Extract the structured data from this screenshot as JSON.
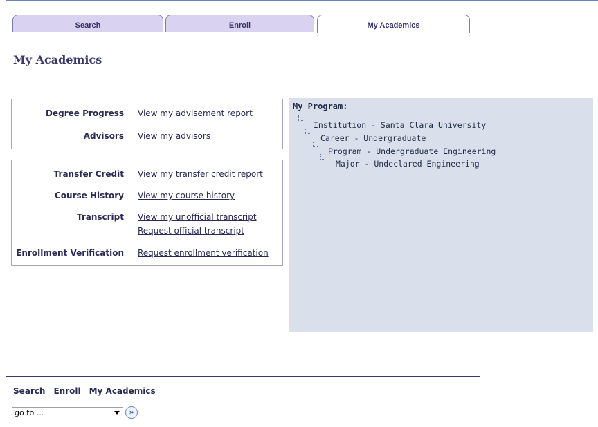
{
  "tabs": [
    {
      "label": "Search",
      "active": false
    },
    {
      "label": "Enroll",
      "active": false
    },
    {
      "label": "My Academics",
      "active": true
    }
  ],
  "page_title": "My Academics",
  "section1": [
    {
      "label": "Degree Progress",
      "links": [
        "View my advisement report"
      ]
    },
    {
      "label": "Advisors",
      "links": [
        "View my advisors"
      ]
    }
  ],
  "section2": [
    {
      "label": "Transfer Credit",
      "links": [
        "View my transfer credit report"
      ]
    },
    {
      "label": "Course History",
      "links": [
        "View my course history"
      ]
    },
    {
      "label": "Transcript",
      "links": [
        "View my unofficial transcript",
        "Request official transcript"
      ]
    },
    {
      "label": "Enrollment Verification",
      "links": [
        "Request enrollment verification"
      ]
    }
  ],
  "program": {
    "title": "My Program:",
    "tree": [
      "Institution - Santa Clara University",
      "Career - Undergraduate",
      "Program - Undergraduate Engineering",
      "Major - Undeclared Engineering"
    ]
  },
  "footer": {
    "links": [
      "Search",
      "Enroll",
      "My Academics"
    ],
    "goto": {
      "value": "go to ..."
    },
    "go_icon": "double-chevron-right-icon"
  },
  "colors": {
    "tab_bg": "#d9d2f0",
    "panel_bg": "#dae0eb",
    "title_color": "#3a3a6a",
    "link_color": "#2a2a55"
  }
}
